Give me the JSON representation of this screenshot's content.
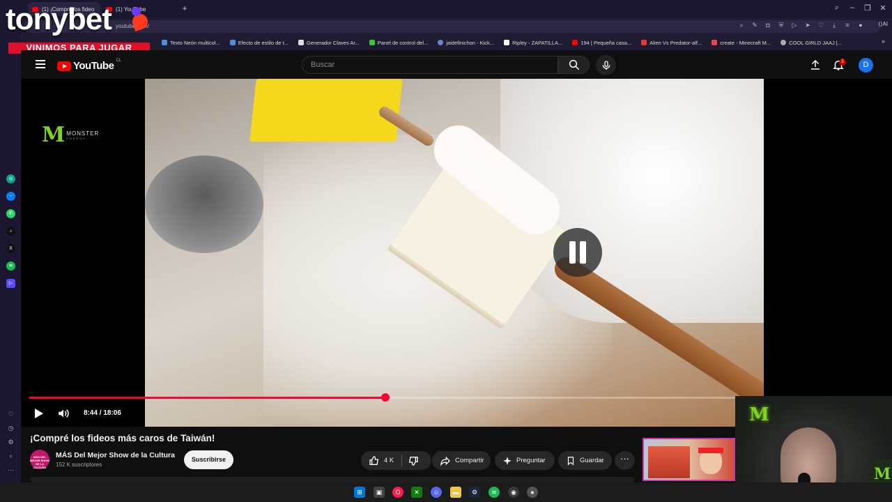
{
  "browser": {
    "tabs": [
      {
        "label": "(1) ¡Compré los fideo",
        "active": true
      },
      {
        "label": "(1) YouTube",
        "active": false
      }
    ],
    "url": "youtube.com/",
    "ai_label": "AI",
    "bookmarks": [
      "Texto Neón multicol...",
      "Efecto de estilo de t...",
      "Generador Claves Ar...",
      "Panel de control del...",
      "jaidefinichon - Kick...",
      "Ripley - ZAPATILLA...",
      "194 | Pequeña casa...",
      "Alien Vs Predator-alf...",
      "create - Minecraft M...",
      "COOL GIRLD JAAJ |..."
    ]
  },
  "overlay": {
    "brand": "tonybet",
    "tagline": "VINIMOS PARA JUGAR"
  },
  "youtube": {
    "logo": "YouTube",
    "country": "CL",
    "search_placeholder": "Buscar",
    "notification_count": "1",
    "avatar_letter": "D"
  },
  "player": {
    "sponsor_logo": "MONSTER",
    "sponsor_sub": "ENERGY",
    "current_time": "8:44",
    "duration": "18:06",
    "time_display": "8:44 / 18:06",
    "progress": 0.4825,
    "state": "paused"
  },
  "video": {
    "title": "¡Compré los fideos más caros de Taiwán!",
    "channel": "MÁS Del Mejor Show de la Cultura",
    "channel_avatar_text": "MÁS DEL MEJOR SHOW DE LA CULTURA",
    "subscribers": "152 K suscriptores",
    "subscribe_label": "Suscribirse",
    "likes": "4 K",
    "share_label": "Compartir",
    "ask_label": "Preguntar",
    "save_label": "Guardar",
    "more_label": "···"
  },
  "colors": {
    "accent_red": "#ff0033",
    "youtube_red": "#ff0000",
    "avatar_blue": "#1a73e8",
    "tonybet_red": "#e0102a",
    "monster_green": "#7ed321"
  }
}
